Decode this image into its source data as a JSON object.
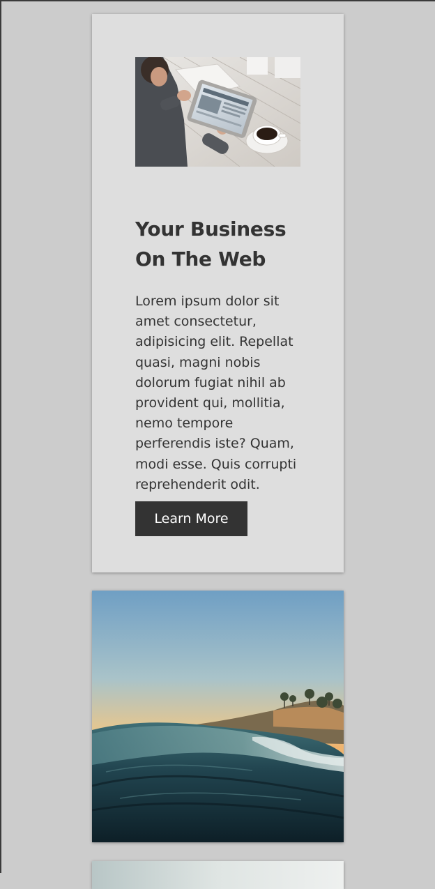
{
  "cards": [
    {
      "title": "Your Business On The Web",
      "body": "Lorem ipsum dolor sit amet consectetur, adipisicing elit. Repellat quasi, magni nobis dolorum fugiat nihil ab provident qui, mollitia, nemo tempore perferendis iste? Quam, modi esse. Quis corrupti reprehenderit odit.",
      "button_label": "Learn More",
      "image": "man-using-tablet-with-coffee-photo"
    },
    {
      "image": "ocean-wave-at-sunset-photo"
    },
    {
      "image": "partially-visible-photo"
    }
  ],
  "colors": {
    "page_background": "#cccccc",
    "card_background": "#dedede",
    "text": "#333333",
    "button_background": "#333333",
    "button_text": "#ffffff"
  }
}
